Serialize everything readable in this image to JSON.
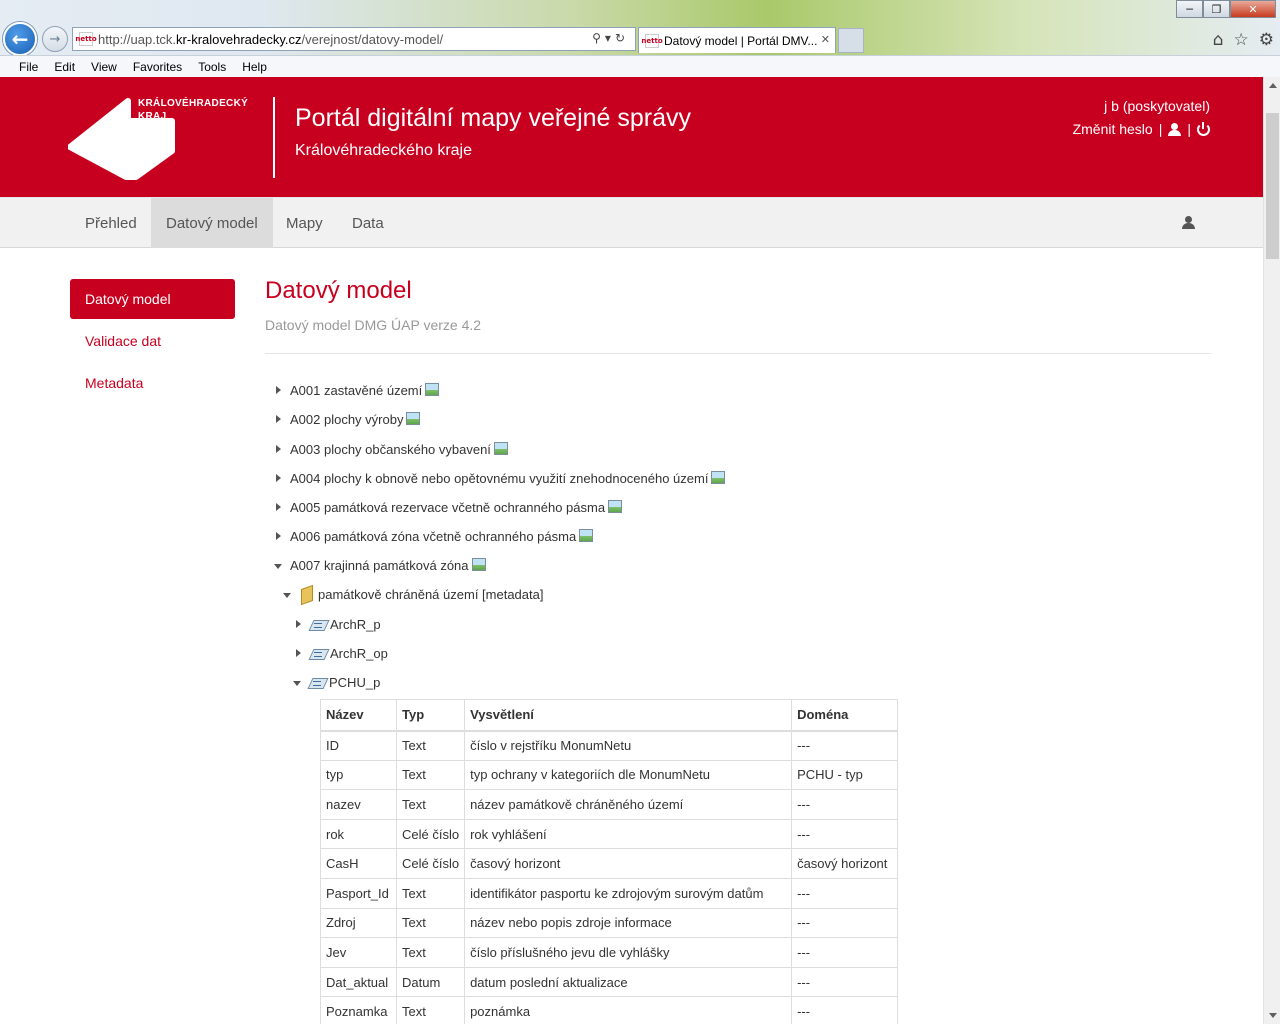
{
  "browser": {
    "url_prefix": "http://uap.tck.",
    "url_domain": "kr-kralovehradecky.cz",
    "url_path": "/verejnost/datovy-model/",
    "tab_title": "Datový model | Portál DMV...",
    "menu": [
      "File",
      "Edit",
      "View",
      "Favorites",
      "Tools",
      "Help"
    ],
    "favicon_text": "netto"
  },
  "header": {
    "logo_line1": "KRÁLOVÉHRADECKÝ",
    "logo_line2": "KRAJ",
    "title": "Portál digitální mapy veřejné správy",
    "subtitle": "Královéhradeckého kraje",
    "user_name": "j b (poskytovatel)",
    "change_password": "Změnit heslo",
    "separator": "|",
    "brand_color": "#c8001f"
  },
  "nav": {
    "items": [
      {
        "label": "Přehled"
      },
      {
        "label": "Datový model"
      },
      {
        "label": "Mapy"
      },
      {
        "label": "Data"
      }
    ],
    "active": "Datový model"
  },
  "sidebar": {
    "items": [
      {
        "label": "Datový model"
      },
      {
        "label": "Validace dat"
      },
      {
        "label": "Metadata"
      }
    ],
    "active": "Datový model"
  },
  "main": {
    "title": "Datový model",
    "subtitle": "Datový model DMG ÚAP verze 4.2",
    "tree": [
      {
        "label": "A001 zastavěné území",
        "expanded": false
      },
      {
        "label": "A002 plochy výroby",
        "expanded": false
      },
      {
        "label": "A003 plochy občanského vybavení",
        "expanded": false
      },
      {
        "label": "A004 plochy k obnově nebo opětovnému využití znehodnoceného území",
        "expanded": false
      },
      {
        "label": "A005 památková rezervace včetně ochranného pásma",
        "expanded": false
      },
      {
        "label": "A006 památková zóna včetně ochranného pásma",
        "expanded": false
      },
      {
        "label": "A007 krajinná památková zóna",
        "expanded": true
      }
    ],
    "folder": {
      "label": "památkově chráněná území [metadata]"
    },
    "layers": [
      {
        "label": "ArchR_p",
        "expanded": false
      },
      {
        "label": "ArchR_op",
        "expanded": false
      },
      {
        "label": "PCHU_p",
        "expanded": true
      }
    ],
    "table": {
      "headers": [
        "Název",
        "Typ",
        "Vysvětlení",
        "Doména"
      ],
      "rows": [
        [
          "ID",
          "Text",
          "číslo v rejstříku MonumNetu",
          "---"
        ],
        [
          "typ",
          "Text",
          "typ ochrany v kategoriích dle MonumNetu",
          "PCHU - typ"
        ],
        [
          "nazev",
          "Text",
          "název památkově chráněného území",
          "---"
        ],
        [
          "rok",
          "Celé číslo",
          "rok vyhlášení",
          "---"
        ],
        [
          "CasH",
          "Celé číslo",
          "časový horizont",
          "časový horizont"
        ],
        [
          "Pasport_Id",
          "Text",
          "identifikátor pasportu ke zdrojovým surovým datům",
          "---"
        ],
        [
          "Zdroj",
          "Text",
          "název nebo popis zdroje informace",
          "---"
        ],
        [
          "Jev",
          "Text",
          "číslo příslušného jevu dle vyhlášky",
          "---"
        ],
        [
          "Dat_aktual",
          "Datum",
          "datum poslední aktualizace",
          "---"
        ],
        [
          "Poznamka",
          "Text",
          "poznámka",
          "---"
        ]
      ]
    }
  }
}
